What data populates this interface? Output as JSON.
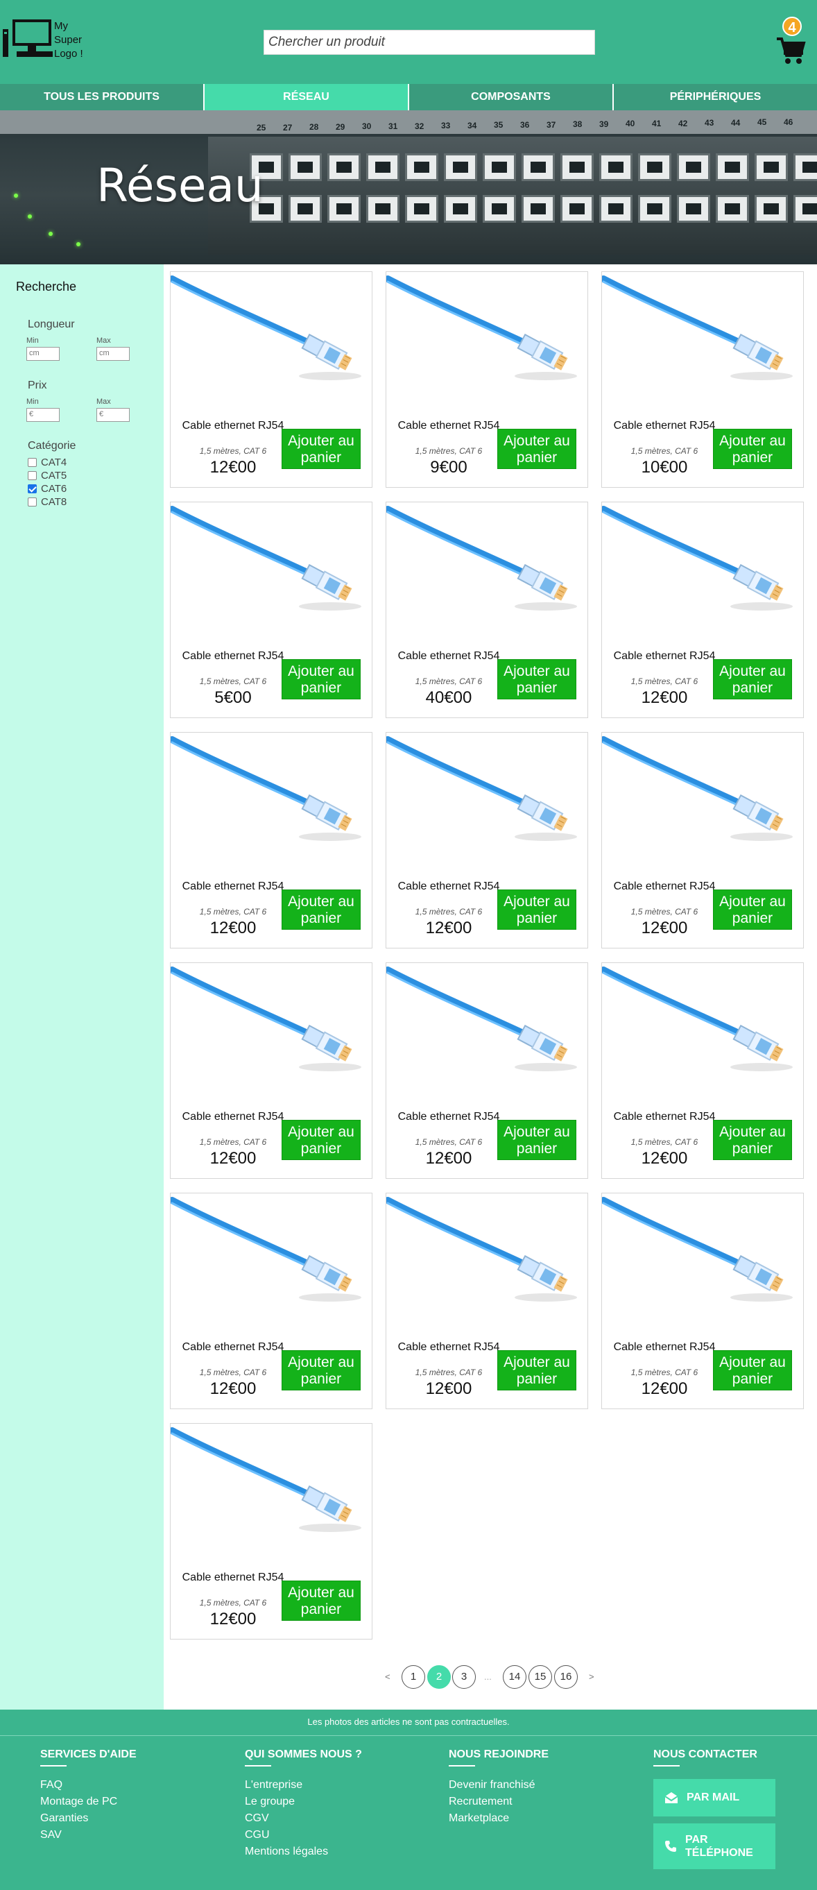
{
  "header": {
    "logo_text": [
      "My",
      "Super",
      "Logo !"
    ],
    "search_placeholder": "Chercher un produit",
    "cart_count": "4"
  },
  "nav": {
    "items": [
      {
        "label": "TOUS LES PRODUITS",
        "active": false
      },
      {
        "label": "RÉSEAU",
        "active": true
      },
      {
        "label": "COMPOSANTS",
        "active": false
      },
      {
        "label": "PÉRIPHÉRIQUES",
        "active": false
      }
    ]
  },
  "banner": {
    "title": "Réseau",
    "port_numbers": [
      "25",
      "27",
      "28",
      "29",
      "30",
      "31",
      "32",
      "33",
      "34",
      "35",
      "36",
      "37",
      "38",
      "39",
      "40",
      "41",
      "42",
      "43",
      "44",
      "45",
      "46"
    ]
  },
  "sidebar": {
    "title": "Recherche",
    "length": {
      "label": "Longueur",
      "min_label": "Min",
      "max_label": "Max",
      "min_placeholder": "cm",
      "max_placeholder": "cm"
    },
    "price": {
      "label": "Prix",
      "min_label": "Min",
      "max_label": "Max",
      "min_placeholder": "€",
      "max_placeholder": "€"
    },
    "category": {
      "label": "Catégorie",
      "options": [
        {
          "label": "CAT4",
          "checked": false
        },
        {
          "label": "CAT5",
          "checked": false
        },
        {
          "label": "CAT6",
          "checked": true
        },
        {
          "label": "CAT8",
          "checked": false
        }
      ]
    }
  },
  "products": [
    {
      "name": "Cable ethernet RJ54",
      "desc": "1,5 mètres, CAT 6",
      "price": "12€00",
      "button": "Ajouter au panier"
    },
    {
      "name": "Cable ethernet RJ54",
      "desc": "1,5 mètres, CAT 6",
      "price": "9€00",
      "button": "Ajouter au panier"
    },
    {
      "name": "Cable ethernet RJ54",
      "desc": "1,5 mètres, CAT 6",
      "price": "10€00",
      "button": "Ajouter au panier"
    },
    {
      "name": "Cable ethernet RJ54",
      "desc": "1,5 mètres, CAT 6",
      "price": "5€00",
      "button": "Ajouter au panier"
    },
    {
      "name": "Cable ethernet RJ54",
      "desc": "1,5 mètres, CAT 6",
      "price": "40€00",
      "button": "Ajouter au panier"
    },
    {
      "name": "Cable ethernet RJ54",
      "desc": "1,5 mètres, CAT 6",
      "price": "12€00",
      "button": "Ajouter au panier"
    },
    {
      "name": "Cable ethernet RJ54",
      "desc": "1,5 mètres, CAT 6",
      "price": "12€00",
      "button": "Ajouter au panier"
    },
    {
      "name": "Cable ethernet RJ54",
      "desc": "1,5 mètres, CAT 6",
      "price": "12€00",
      "button": "Ajouter au panier"
    },
    {
      "name": "Cable ethernet RJ54",
      "desc": "1,5 mètres, CAT 6",
      "price": "12€00",
      "button": "Ajouter au panier"
    },
    {
      "name": "Cable ethernet RJ54",
      "desc": "1,5 mètres, CAT 6",
      "price": "12€00",
      "button": "Ajouter au panier"
    },
    {
      "name": "Cable ethernet RJ54",
      "desc": "1,5 mètres, CAT 6",
      "price": "12€00",
      "button": "Ajouter au panier"
    },
    {
      "name": "Cable ethernet RJ54",
      "desc": "1,5 mètres, CAT 6",
      "price": "12€00",
      "button": "Ajouter au panier"
    },
    {
      "name": "Cable ethernet RJ54",
      "desc": "1,5 mètres, CAT 6",
      "price": "12€00",
      "button": "Ajouter au panier"
    },
    {
      "name": "Cable ethernet RJ54",
      "desc": "1,5 mètres, CAT 6",
      "price": "12€00",
      "button": "Ajouter au panier"
    },
    {
      "name": "Cable ethernet RJ54",
      "desc": "1,5 mètres, CAT 6",
      "price": "12€00",
      "button": "Ajouter au panier"
    },
    {
      "name": "Cable ethernet RJ54",
      "desc": "1,5 mètres, CAT 6",
      "price": "12€00",
      "button": "Ajouter au panier"
    }
  ],
  "pagination": {
    "prev": "<",
    "next": ">",
    "dots": "...",
    "pages": [
      {
        "label": "1",
        "active": false
      },
      {
        "label": "2",
        "active": true
      },
      {
        "label": "3",
        "active": false
      },
      {
        "label": "14",
        "active": false
      },
      {
        "label": "15",
        "active": false
      },
      {
        "label": "16",
        "active": false
      }
    ]
  },
  "footer": {
    "disclaimer": "Les photos des articles ne sont pas contractuelles.",
    "columns": [
      {
        "title": "SERVICES D'AIDE",
        "links": [
          "FAQ",
          "Montage de PC",
          "Garanties",
          "SAV"
        ]
      },
      {
        "title": "QUI SOMMES NOUS ?",
        "links": [
          "L'entreprise",
          "Le groupe",
          "CGV",
          "CGU",
          "Mentions légales"
        ]
      },
      {
        "title": "NOUS REJOINDRE",
        "links": [
          "Devenir franchisé",
          "Recrutement",
          "Marketplace"
        ]
      },
      {
        "title": "NOUS CONTACTER",
        "links": []
      }
    ],
    "contact": {
      "mail": "PAR MAIL",
      "phone_line1": "PAR",
      "phone_line2": "TÉLÉPHONE"
    }
  },
  "colors": {
    "primary": "#3bb58e",
    "accent": "#45dbaa",
    "sidebar_bg": "#c4fbe9",
    "button_green": "#14b21a",
    "badge_orange": "#f5a623"
  },
  "icons": [
    "computer-logo-icon",
    "cart-icon",
    "mail-icon",
    "phone-icon",
    "cable-image"
  ]
}
